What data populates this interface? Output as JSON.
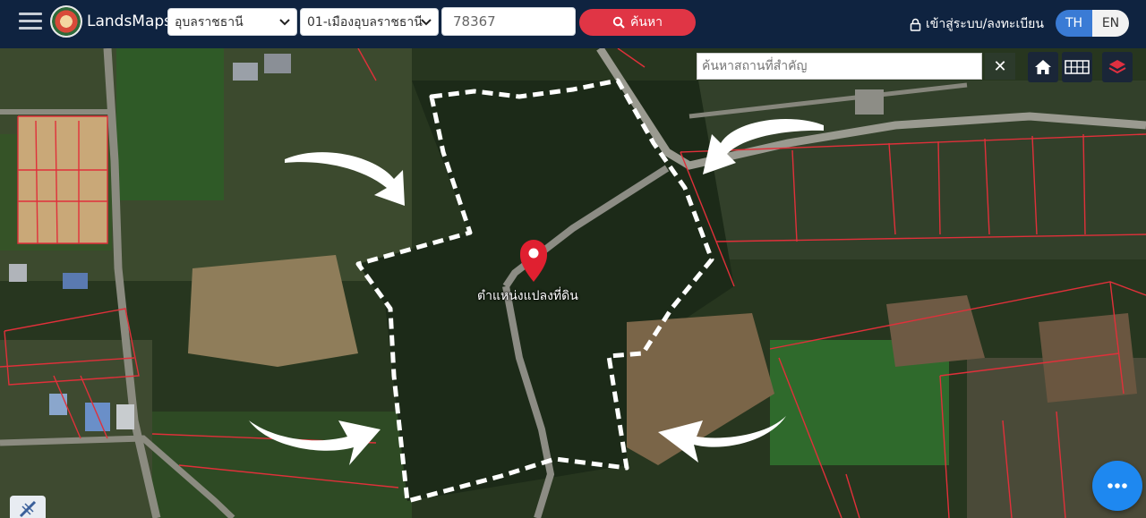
{
  "header": {
    "brand": "LandsMaps",
    "province": "อุบลราชธานี",
    "district": "01-เมืองอุบลราชธานี",
    "parcel_number": "78367",
    "search_label": "ค้นหา",
    "login_label": "เข้าสู่ระบบ/ลงทะเบียน",
    "lang_th": "TH",
    "lang_en": "EN",
    "active_lang": "TH"
  },
  "map": {
    "place_search_placeholder": "ค้นหาสถานที่สำคัญ",
    "clear_label": "✕",
    "pin_label": "ตำแหน่งแปลงที่ดิน",
    "icons": [
      "home-icon",
      "grid-icon",
      "layers-icon",
      "chat-icon",
      "measure-icon"
    ]
  },
  "colors": {
    "header_bg": "#0f2340",
    "search_button": "#e03545",
    "lang_active": "#3a7bd5",
    "pin": "#e02030",
    "parcel_lines": "#e0303a",
    "chat_button": "#1e88f0"
  }
}
